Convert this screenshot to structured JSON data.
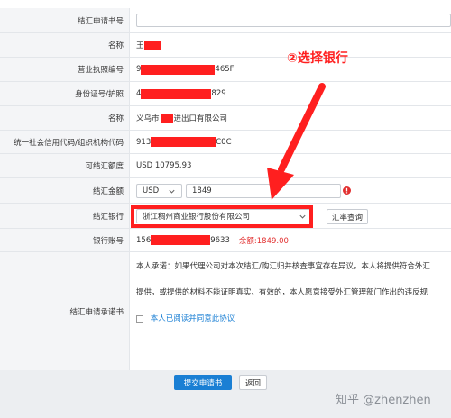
{
  "rows": {
    "app_no": {
      "label": "结汇申请书号"
    },
    "name1": {
      "label": "名称",
      "value": "王"
    },
    "license": {
      "label": "营业执照编号",
      "prefix": "9",
      "suffix": "465F"
    },
    "idcard": {
      "label": "身份证号/护照",
      "prefix": "4",
      "suffix": "829"
    },
    "name2": {
      "label": "名称",
      "prefix": "义乌市",
      "suffix": "进出口有限公司"
    },
    "credit": {
      "label": "统一社会信用代码/组织机构代码",
      "prefix": "913",
      "suffix": "C0C"
    },
    "available": {
      "label": "可结汇额度",
      "value": "USD 10795.93"
    },
    "amount": {
      "label": "结汇金额",
      "currency": "USD",
      "value": "1849"
    },
    "bank": {
      "label": "结汇银行",
      "selected": "浙江稠州商业银行股份有限公司",
      "rate_button": "汇率查询"
    },
    "account": {
      "label": "银行账号",
      "prefix": "156",
      "suffix": "9633",
      "balance": "余额:1849.00"
    },
    "promise": {
      "label": "结汇申请承诺书",
      "line1": "本人承诺：如果代理公司对本次结汇/购汇归并核查事宜存在异议，本人将提供符合外汇",
      "line2": "提供，或提供的材料不能证明真实、有效的，本人愿意接受外汇管理部门作出的违反规",
      "agree": "本人已阅读并同意此协议"
    }
  },
  "annotation": {
    "text": "②选择银行"
  },
  "buttons": {
    "submit": "提交申请书",
    "back": "返回"
  },
  "watermark": "知乎 @zhenzhen",
  "colors": {
    "red": "#ff1f1f",
    "blue": "#1a7fd4",
    "label_bg": "#f4f5f7",
    "bottom_bg": "#eceef1"
  }
}
